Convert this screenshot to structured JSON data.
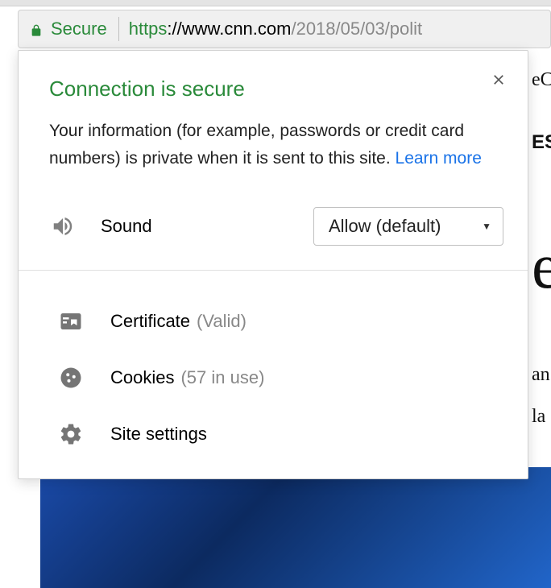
{
  "address_bar": {
    "secure_label": "Secure",
    "url_scheme": "https",
    "url_host": "://www.cnn.com",
    "url_path": "/2018/05/03/polit"
  },
  "popup": {
    "title": "Connection is secure",
    "description": "Your information (for example, passwords or credit card numbers) is private when it is sent to this site. ",
    "learn_more": "Learn more",
    "sound": {
      "label": "Sound",
      "selected": "Allow (default)"
    },
    "certificate": {
      "label": "Certificate",
      "status": "(Valid)"
    },
    "cookies": {
      "label": "Cookies",
      "count": 57,
      "status": "(57 in use)"
    },
    "site_settings": {
      "label": "Site settings"
    }
  },
  "bg_text": [
    "eC",
    "ES",
    "e",
    "an",
    "la"
  ]
}
